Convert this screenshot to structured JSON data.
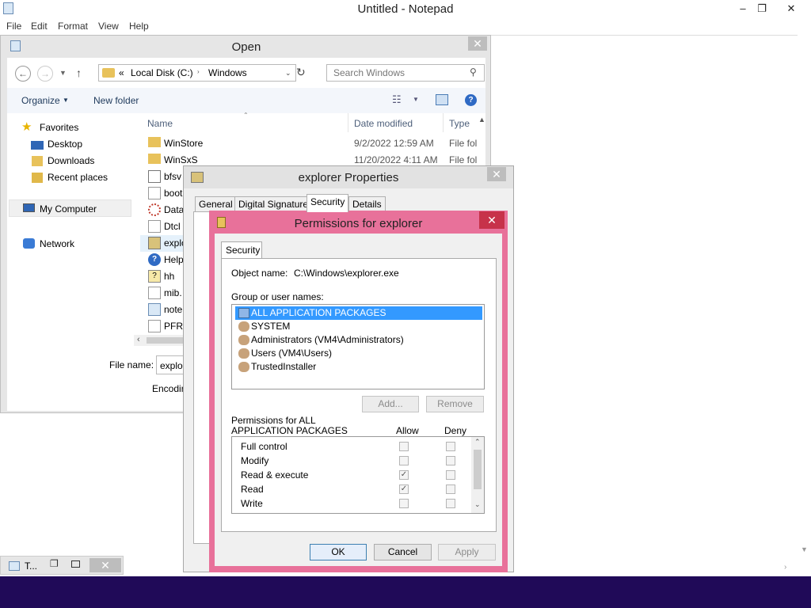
{
  "notepad": {
    "title": "Untitled - Notepad",
    "menu": [
      "File",
      "Edit",
      "Format",
      "View",
      "Help"
    ],
    "minimize": "–",
    "restore": "❐",
    "close": "✕"
  },
  "open_dialog": {
    "title": "Open",
    "close": "✕",
    "breadcrumb": {
      "prefix": "«",
      "parts": [
        "Local Disk (C:)",
        "Windows"
      ]
    },
    "search_placeholder": "Search Windows",
    "toolbar": {
      "organize": "Organize",
      "new_folder": "New folder"
    },
    "nav": {
      "favorites": "Favorites",
      "desktop": "Desktop",
      "downloads": "Downloads",
      "recent": "Recent places",
      "my_computer": "My Computer",
      "network": "Network"
    },
    "columns": {
      "name": "Name",
      "date": "Date modified",
      "type": "Type"
    },
    "files": [
      {
        "name": "WinStore",
        "date": "9/2/2022 12:59 AM",
        "type": "File fol"
      },
      {
        "name": "WinSxS",
        "date": "11/20/2022 4:11 AM",
        "type": "File fol"
      },
      {
        "name": "bfsv",
        "date": "",
        "type": ""
      },
      {
        "name": "boot",
        "date": "",
        "type": ""
      },
      {
        "name": "Data",
        "date": "",
        "type": ""
      },
      {
        "name": "Dtcl",
        "date": "",
        "type": ""
      },
      {
        "name": "explo",
        "date": "",
        "type": ""
      },
      {
        "name": "Help",
        "date": "",
        "type": ""
      },
      {
        "name": "hh",
        "date": "",
        "type": ""
      },
      {
        "name": "mib.",
        "date": "",
        "type": ""
      },
      {
        "name": "note",
        "date": "",
        "type": ""
      },
      {
        "name": "PFRO",
        "date": "",
        "type": ""
      }
    ],
    "file_name_label": "File name:",
    "file_name_value": "explo",
    "encoding_label": "Encodir"
  },
  "properties": {
    "title": "explorer Properties",
    "close": "✕",
    "tabs": [
      "General",
      "Digital Signatures",
      "Security",
      "Details"
    ],
    "active_tab": "Security"
  },
  "permissions": {
    "title": "Permissions for explorer",
    "close": "✕",
    "tab": "Security",
    "object_name_label": "Object name:",
    "object_name_value": "C:\\Windows\\explorer.exe",
    "group_label": "Group or user names:",
    "groups": [
      {
        "name": "ALL APPLICATION PACKAGES",
        "selected": true
      },
      {
        "name": "SYSTEM",
        "selected": false
      },
      {
        "name": "Administrators (VM4\\Administrators)",
        "selected": false
      },
      {
        "name": "Users (VM4\\Users)",
        "selected": false
      },
      {
        "name": "TrustedInstaller",
        "selected": false
      }
    ],
    "add_button": "Add...",
    "remove_button": "Remove",
    "perms_for_label_line1": "Permissions for ALL",
    "perms_for_label_line2": "APPLICATION PACKAGES",
    "allow_header": "Allow",
    "deny_header": "Deny",
    "rows": [
      {
        "name": "Full control",
        "allow": false,
        "deny": false
      },
      {
        "name": "Modify",
        "allow": false,
        "deny": false
      },
      {
        "name": "Read & execute",
        "allow": true,
        "deny": false
      },
      {
        "name": "Read",
        "allow": true,
        "deny": false
      },
      {
        "name": "Write",
        "allow": false,
        "deny": false
      }
    ],
    "ok": "OK",
    "cancel": "Cancel",
    "apply": "Apply"
  },
  "taskbar_thumb": {
    "label": "T...",
    "close": "✕"
  },
  "colors": {
    "accent_pink": "#e8719a",
    "close_red": "#c7324a",
    "selection": "#3399ff",
    "taskbar": "#200a58"
  }
}
